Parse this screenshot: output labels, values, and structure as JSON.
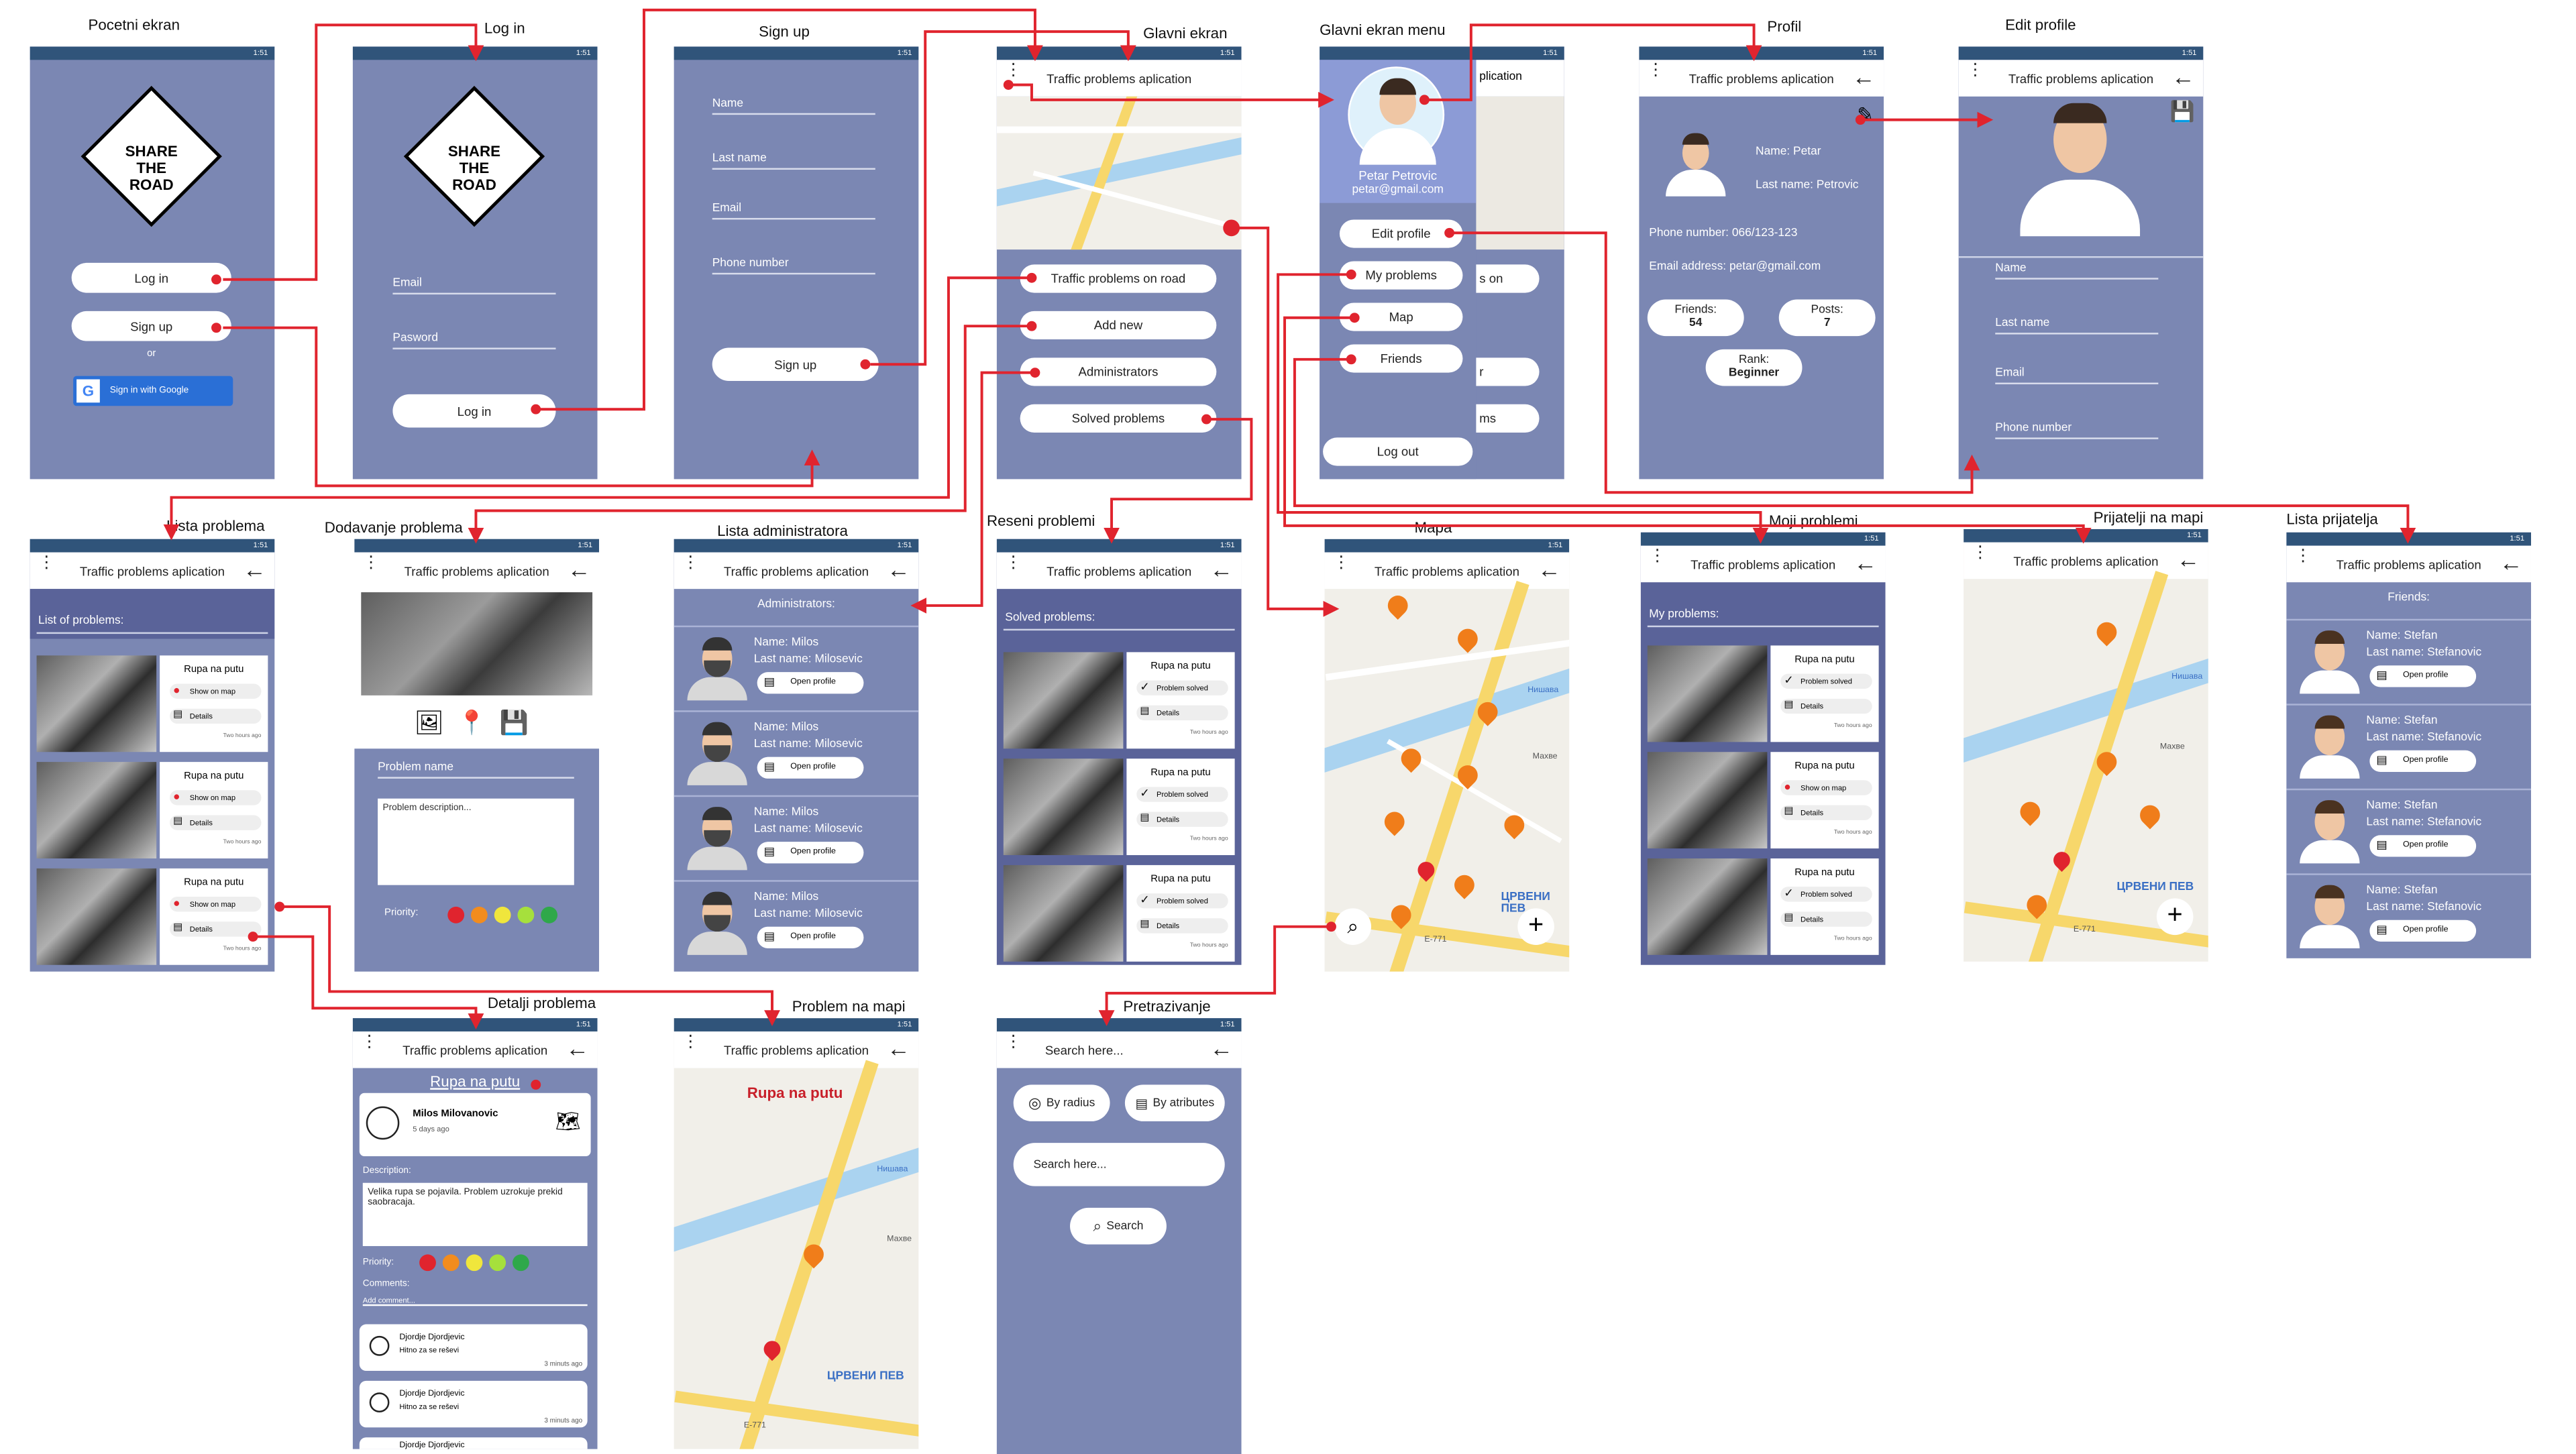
{
  "status_time": "1:51",
  "app_title": "Traffic problems aplication",
  "sign_text": [
    "SHARE",
    "THE",
    "ROAD"
  ],
  "screens": {
    "pocetni": {
      "title": "Pocetni ekran",
      "login": "Log in",
      "signup": "Sign up",
      "or": "or",
      "google": "Sign in with Google"
    },
    "login": {
      "title": "Log in",
      "email": "Email",
      "password": "Pasword",
      "button": "Log in"
    },
    "signup": {
      "title": "Sign up",
      "fields": [
        "Name",
        "Last name",
        "Email",
        "Phone number"
      ],
      "button": "Sign up"
    },
    "glavni": {
      "title": "Glavni ekran",
      "buttons": [
        "Traffic problems on road",
        "Add new",
        "Administrators",
        "Solved problems"
      ]
    },
    "menu": {
      "title": "Glavni ekran menu",
      "name": "Petar Petrovic",
      "email": "petar@gmail.com",
      "items": [
        "Edit profile",
        "My problems",
        "Map",
        "Friends"
      ],
      "logout": "Log out",
      "behind": [
        "plication",
        "s on",
        "r",
        "ms"
      ]
    },
    "profil": {
      "title": "Profil",
      "name": "Name: Petar",
      "last": "Last name: Petrovic",
      "phone": "Phone number: 066/123-123",
      "email": "Email address: petar@gmail.com",
      "friends_label": "Friends:",
      "friends": "54",
      "posts_label": "Posts:",
      "posts": "7",
      "rank_label": "Rank:",
      "rank": "Beginner"
    },
    "edit": {
      "title": "Edit profile",
      "fields": [
        "Name",
        "Last name",
        "Email",
        "Phone number"
      ]
    },
    "lista": {
      "title": "Lista problema",
      "heading": "List of problems:",
      "item": "Rupa na putu",
      "show": "Show on map",
      "details": "Details",
      "ago": "Two hours ago"
    },
    "dodavanje": {
      "title": "Dodavanje problema",
      "name": "Problem name",
      "desc": "Problem description...",
      "priority": "Priority:"
    },
    "admins": {
      "title": "Lista administratora",
      "heading": "Administrators:",
      "name": "Name: Milos",
      "last": "Last name: Milosevic",
      "open": "Open profile"
    },
    "reseni": {
      "title": "Reseni problemi",
      "heading": "Solved problems:",
      "item": "Rupa na putu",
      "solved": "Problem solved",
      "details": "Details",
      "ago": "Two hours ago"
    },
    "mapa": {
      "title": "Mapa"
    },
    "moji": {
      "title": "Moji problemi",
      "heading": "My problems:",
      "item": "Rupa na putu",
      "solved": "Problem solved",
      "show": "Show on map",
      "details": "Details",
      "ago": "Two hours ago"
    },
    "prijatelji_mapa": {
      "title": "Prijatelji na mapi"
    },
    "prijatelji": {
      "title": "Lista prijatelja",
      "heading": "Friends:",
      "name": "Name: Stefan",
      "last": "Last name: Stefanovic",
      "open": "Open profile"
    },
    "detalji": {
      "title": "Detalji problema",
      "heading": "Rupa na putu",
      "user": "Milos Milovanovic",
      "time": "5 days ago",
      "desc_label": "Description:",
      "desc": "Velika rupa se pojavila. Problem uzrokuje prekid saobracaja.",
      "priority": "Priority:",
      "comments": "Comments:",
      "add": "Add comment...",
      "c1_user": "Djordje Djordjevic",
      "c1_text": "Hitno za se reševi",
      "c1_time": "3 minuts ago",
      "c2_user": "Djordje Djordjevic",
      "c2_text": "Hitno za se reševi",
      "c2_time": "3 minuts ago",
      "c3_user": "Djordje Djordjevic"
    },
    "problem_mapa": {
      "title": "Problem na mapi",
      "heading": "Rupa na putu"
    },
    "pretrazivanje": {
      "title": "Pretrazivanje",
      "search_header": "Search here...",
      "radius": "By radius",
      "attr": "By atributes",
      "input": "Search here...",
      "button": "Search"
    }
  },
  "map_labels": {
    "district": "ЦРВЕНИ ПЕВ",
    "road": "E-771",
    "river": "Нишава",
    "place": "Махве"
  },
  "colors": {
    "screen": "#7b87b3",
    "statusbar": "#30547a",
    "arrow": "#e0242e",
    "pin": "#f07d1a"
  }
}
